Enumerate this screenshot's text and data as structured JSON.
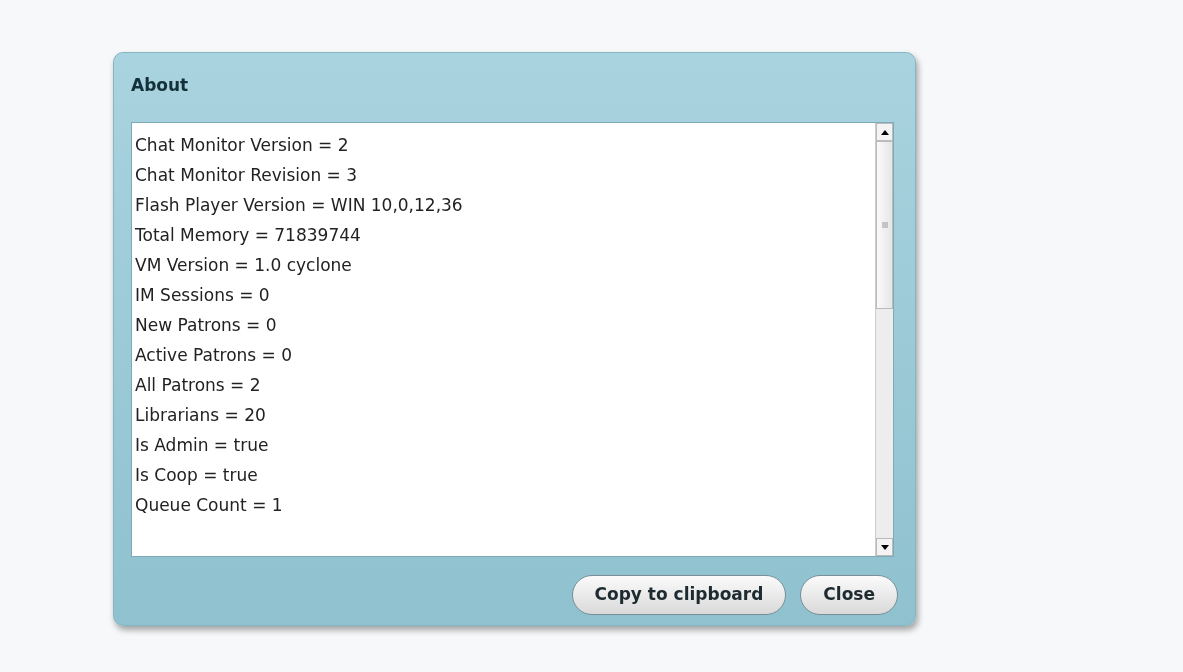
{
  "dialog": {
    "title": "About",
    "lines": [
      "Chat Monitor Version = 2",
      "Chat Monitor Revision = 3",
      "Flash Player Version = WIN 10,0,12,36",
      "Total Memory = 71839744",
      "VM Version = 1.0 cyclone",
      "IM Sessions = 0",
      "New Patrons = 0",
      "Active Patrons = 0",
      "All Patrons = 2",
      "Librarians = 20",
      "Is Admin = true",
      "Is Coop = true",
      "Queue Count = 1"
    ],
    "buttons": [
      "Copy to clipboard",
      "Close"
    ]
  }
}
